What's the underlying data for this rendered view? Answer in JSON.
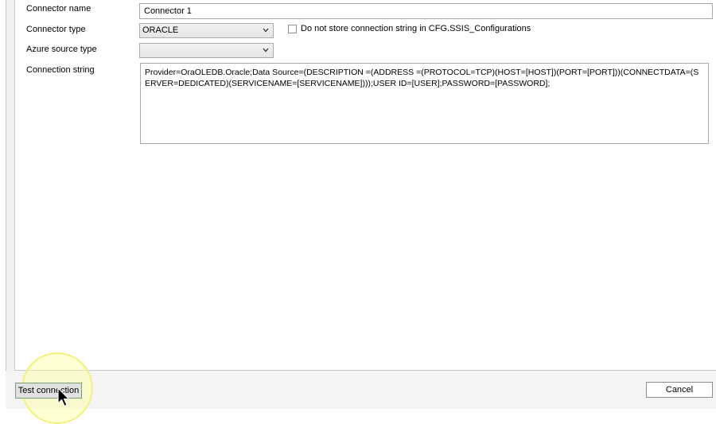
{
  "form": {
    "connector_name": {
      "label": "Connector name",
      "value": "Connector 1"
    },
    "connector_type": {
      "label": "Connector type",
      "value": "ORACLE"
    },
    "store_checkbox": {
      "label": "Do not store connection string in CFG.SSIS_Configurations",
      "checked": false
    },
    "azure_source_type": {
      "label": "Azure source type",
      "value": ""
    },
    "connection_string": {
      "label": "Connection string",
      "value": "Provider=OraOLEDB.Oracle;Data Source=(DESCRIPTION =(ADDRESS =(PROTOCOL=TCP)(HOST=[HOST])(PORT=[PORT]))(CONNECTDATA=(SERVER=DEDICATED)(SERVICENAME=[SERVICENAME])));USER ID=[USER];PASSWORD=[PASSWORD];"
    }
  },
  "buttons": {
    "test_connection": "Test connection",
    "cancel": "Cancel"
  },
  "icons": {
    "dropdown": "chevron-down-icon",
    "cursor": "mouse-pointer-icon"
  },
  "colors": {
    "highlight": "#ffff99",
    "border": "#a9a9a9"
  }
}
